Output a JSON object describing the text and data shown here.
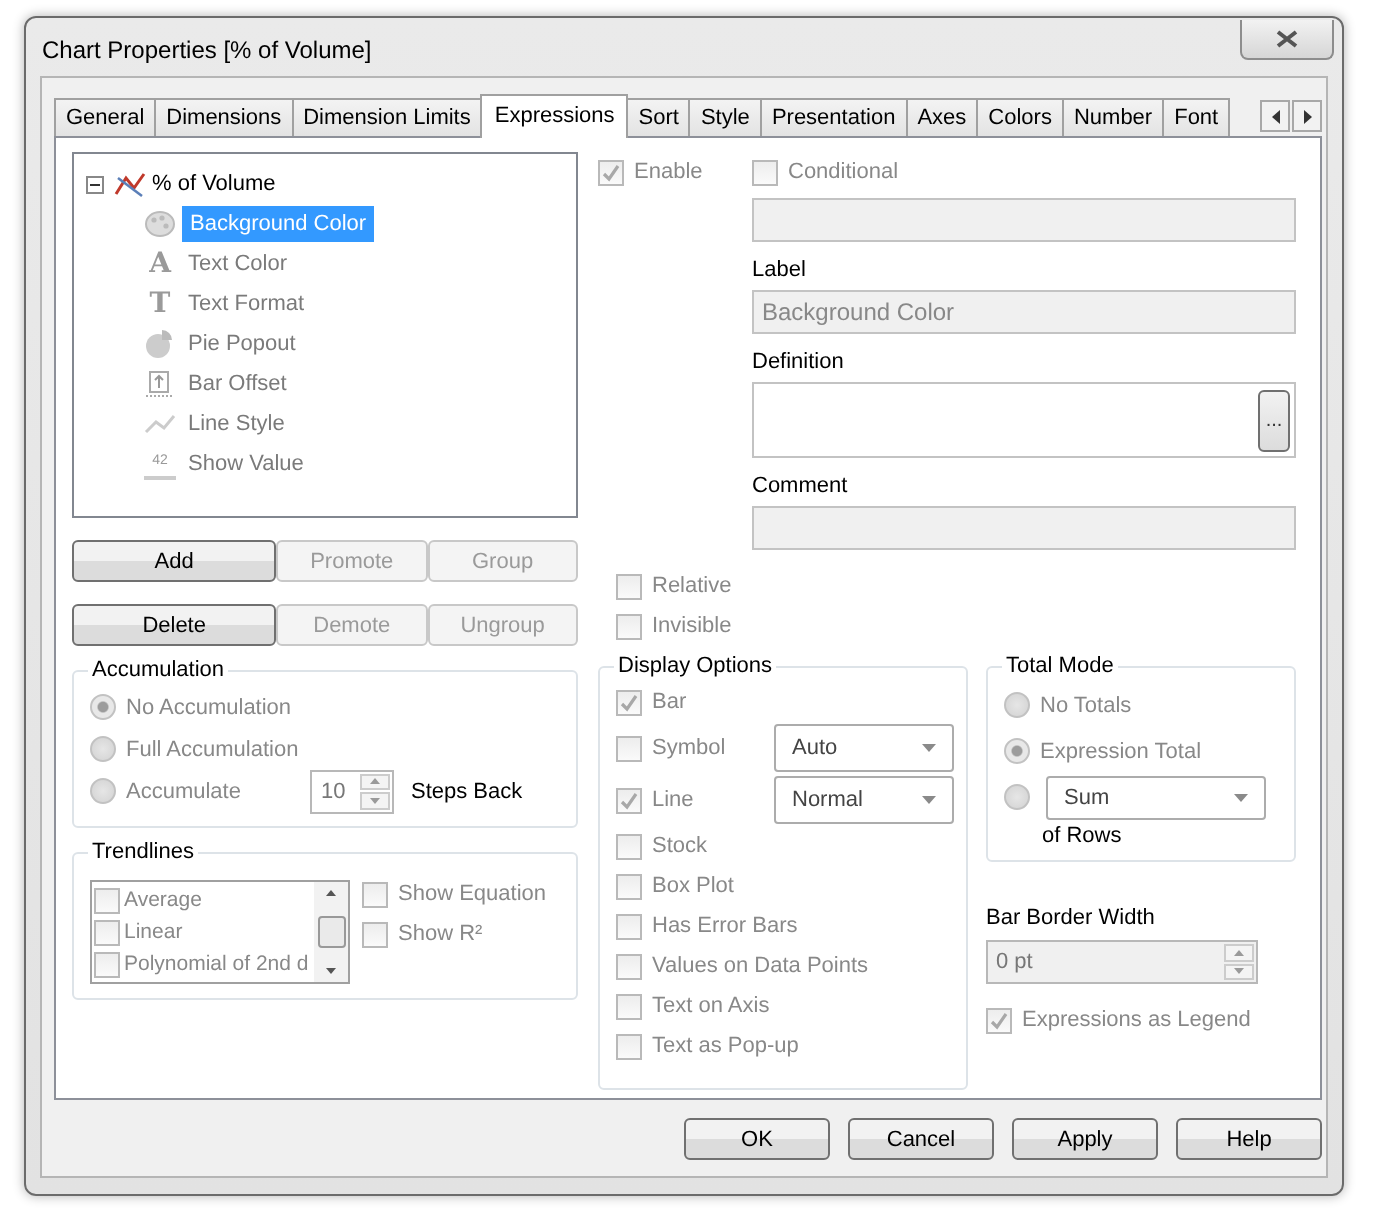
{
  "window": {
    "title": "Chart Properties [% of Volume]"
  },
  "tabs": [
    {
      "label": "General",
      "selected": false
    },
    {
      "label": "Dimensions",
      "selected": false
    },
    {
      "label": "Dimension Limits",
      "selected": false
    },
    {
      "label": "Expressions",
      "selected": true
    },
    {
      "label": "Sort",
      "selected": false
    },
    {
      "label": "Style",
      "selected": false
    },
    {
      "label": "Presentation",
      "selected": false
    },
    {
      "label": "Axes",
      "selected": false
    },
    {
      "label": "Colors",
      "selected": false
    },
    {
      "label": "Number",
      "selected": false
    },
    {
      "label": "Font",
      "selected": false
    }
  ],
  "expression_tree": [
    {
      "label": "% of Volume",
      "kind": "chart",
      "expanded": true,
      "selected": false,
      "children": [
        {
          "label": "Background Color",
          "kind": "palette",
          "selected": true
        },
        {
          "label": "Text Color",
          "kind": "glyph",
          "glyph": "A",
          "selected": false
        },
        {
          "label": "Text Format",
          "kind": "glyph",
          "glyph": "T",
          "selected": false
        },
        {
          "label": "Pie Popout",
          "kind": "pie",
          "selected": false
        },
        {
          "label": "Bar Offset",
          "kind": "offset",
          "selected": false
        },
        {
          "label": "Line Style",
          "kind": "line",
          "selected": false
        },
        {
          "label": "Show Value",
          "kind": "value",
          "glyph": "42",
          "selected": false
        }
      ]
    }
  ],
  "tree_buttons": [
    [
      {
        "label": "Add",
        "disabled": false
      },
      {
        "label": "Promote",
        "disabled": true
      },
      {
        "label": "Group",
        "disabled": true
      }
    ],
    [
      {
        "label": "Delete",
        "disabled": false
      },
      {
        "label": "Demote",
        "disabled": true
      },
      {
        "label": "Ungroup",
        "disabled": true
      }
    ]
  ],
  "accumulation": {
    "title": "Accumulation",
    "options": [
      {
        "label": "No Accumulation",
        "selected": true
      },
      {
        "label": "Full Accumulation",
        "selected": false
      },
      {
        "label": "Accumulate",
        "selected": false
      }
    ],
    "steps": "10",
    "steps_label": "Steps Back"
  },
  "trendlines": {
    "title": "Trendlines",
    "items": [
      {
        "label": "Average",
        "checked": false
      },
      {
        "label": "Linear",
        "checked": false
      },
      {
        "label": "Polynomial of 2nd d",
        "checked": false
      }
    ],
    "options": [
      {
        "label": "Show Equation",
        "checked": false
      },
      {
        "label": "Show R²",
        "checked": false
      }
    ]
  },
  "enable": {
    "label": "Enable",
    "checked": true
  },
  "conditional": {
    "label": "Conditional",
    "checked": false
  },
  "fields": [
    {
      "label": "Label",
      "value": "Background Color",
      "kind": "text"
    },
    {
      "label": "Definition",
      "kind": "expression",
      "button": "..."
    },
    {
      "label": "Comment",
      "kind": "text"
    }
  ],
  "flags": [
    {
      "label": "Relative",
      "checked": false
    },
    {
      "label": "Invisible",
      "checked": false
    }
  ],
  "display_options": {
    "title": "Display Options",
    "items": [
      {
        "label": "Bar",
        "checked": true
      },
      {
        "label": "Symbol",
        "checked": false,
        "select": "Auto"
      },
      {
        "label": "Line",
        "checked": true,
        "select": "Normal"
      },
      {
        "label": "Stock",
        "checked": false
      },
      {
        "label": "Box Plot",
        "checked": false
      },
      {
        "label": "Has Error Bars",
        "checked": false
      },
      {
        "label": "Values on Data Points",
        "checked": false
      },
      {
        "label": "Text on Axis",
        "checked": false
      },
      {
        "label": "Text as Pop-up",
        "checked": false
      }
    ]
  },
  "total_mode": {
    "title": "Total Mode",
    "options": [
      {
        "label": "No Totals",
        "selected": false
      },
      {
        "label": "Expression Total",
        "selected": true
      },
      {
        "select": "Sum",
        "selected": false
      }
    ],
    "suffix": "of Rows"
  },
  "bar_border_width": {
    "label": "Bar Border Width",
    "value": "0 pt"
  },
  "expressions_as_legend": {
    "label": "Expressions as Legend",
    "checked": true
  },
  "buttons": [
    "OK",
    "Cancel",
    "Apply",
    "Help"
  ]
}
